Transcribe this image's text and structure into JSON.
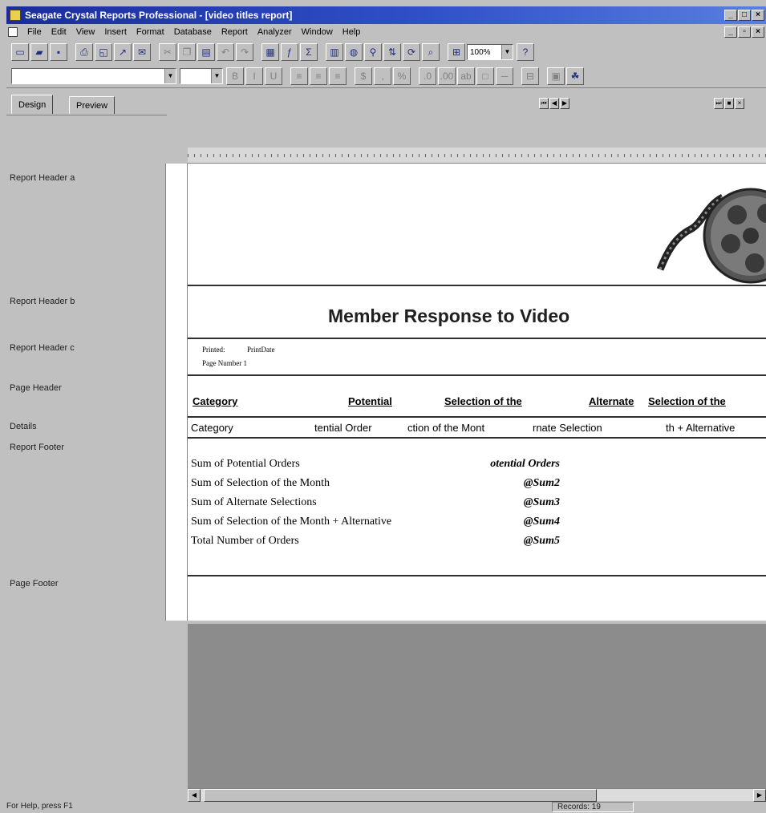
{
  "window": {
    "title": "Seagate Crystal Reports Professional - [video titles report]"
  },
  "menu": [
    "File",
    "Edit",
    "View",
    "Insert",
    "Format",
    "Database",
    "Report",
    "Analyzer",
    "Window",
    "Help"
  ],
  "toolbar": {
    "zoom": "100%"
  },
  "tabs": {
    "design": "Design",
    "preview": "Preview"
  },
  "sections": {
    "report_header_a": "Report Header a",
    "report_header_b": "Report Header b",
    "report_header_c": "Report Header c",
    "page_header": "Page Header",
    "details": "Details",
    "report_footer": "Report Footer",
    "page_footer": "Page Footer"
  },
  "report": {
    "title": "Member Response to Video",
    "printed_label": "Printed:",
    "print_date": "PrintDate",
    "page_number": "Page Number 1",
    "headers": [
      "Category",
      "Potential",
      "Selection of the",
      "Alternate",
      "Selection of the"
    ],
    "details": [
      "Category",
      "tential Order",
      "ction of the Mont",
      "rnate Selection",
      "th + Alternative"
    ],
    "footer_labels": [
      "Sum of Potential Orders",
      "Sum of Selection of the Month",
      "Sum of Alternate Selections",
      "Sum of Selection of the Month + Alternative",
      "Total Number of Orders"
    ],
    "footer_values": [
      "otential Orders",
      "@Sum2",
      "@Sum3",
      "@Sum4",
      "@Sum5"
    ]
  },
  "status": {
    "help": "For Help, press F1",
    "records": "Records: 19"
  }
}
